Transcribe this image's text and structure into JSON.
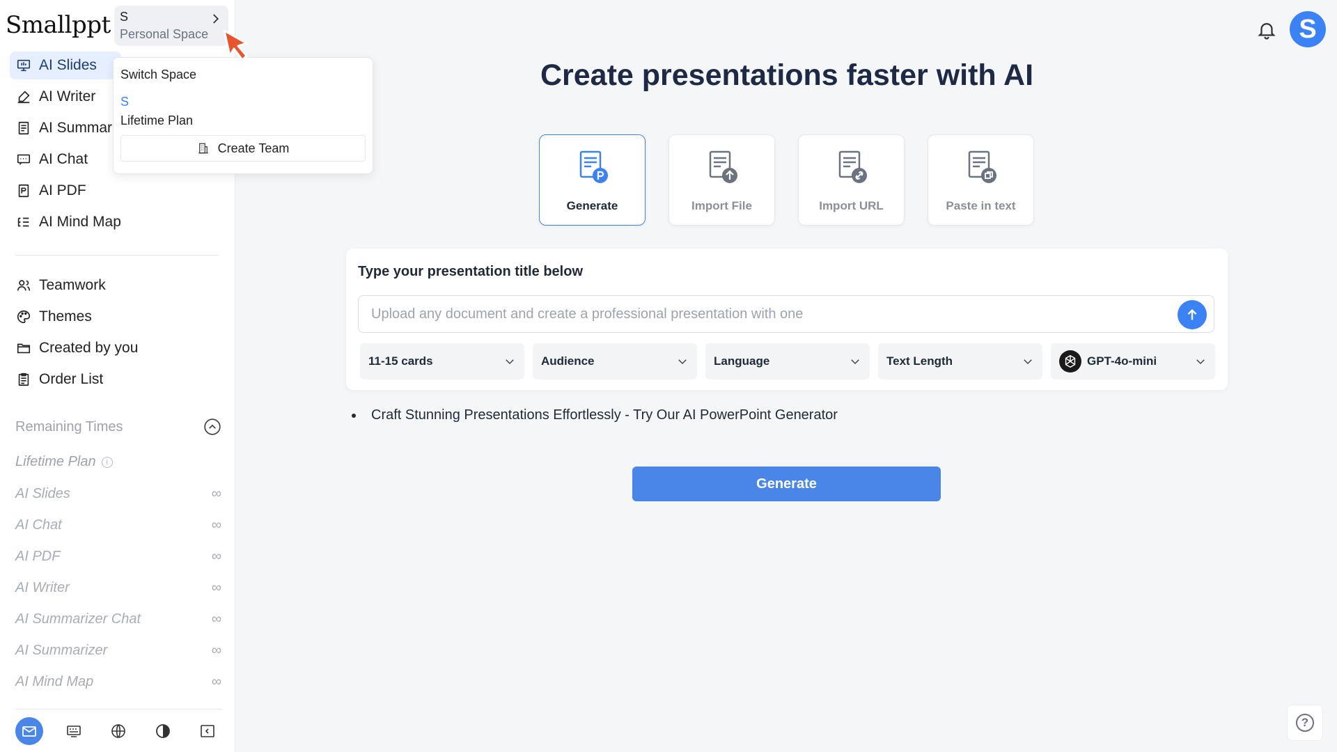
{
  "brand": {
    "logo": "Smallppt",
    "accent": "#3b82f6"
  },
  "space": {
    "name": "S",
    "subtitle": "Personal Space"
  },
  "space_menu": {
    "title": "Switch Space",
    "space_name": "S",
    "plan": "Lifetime Plan",
    "create_team": "Create Team"
  },
  "sidebar": {
    "nav": [
      {
        "label": "AI Slides",
        "icon": "slides-icon"
      },
      {
        "label": "AI Writer",
        "icon": "pen-icon"
      },
      {
        "label": "AI Summarizer",
        "icon": "document-icon"
      },
      {
        "label": "AI Chat",
        "icon": "chat-icon"
      },
      {
        "label": "AI PDF",
        "icon": "pdf-icon"
      },
      {
        "label": "AI Mind Map",
        "icon": "mindmap-icon"
      }
    ],
    "nav2": [
      {
        "label": "Teamwork",
        "icon": "team-icon"
      },
      {
        "label": "Themes",
        "icon": "palette-icon"
      },
      {
        "label": "Created by you",
        "icon": "folder-icon"
      },
      {
        "label": "Order List",
        "icon": "clipboard-icon"
      }
    ],
    "remaining": {
      "title": "Remaining Times",
      "plan": "Lifetime Plan",
      "info": "i",
      "items": [
        {
          "label": "AI Slides",
          "value": "∞"
        },
        {
          "label": "AI Chat",
          "value": "∞"
        },
        {
          "label": "AI PDF",
          "value": "∞"
        },
        {
          "label": "AI Writer",
          "value": "∞"
        },
        {
          "label": "AI Summarizer Chat",
          "value": "∞"
        },
        {
          "label": "AI Summarizer",
          "value": "∞"
        },
        {
          "label": "AI Mind Map",
          "value": "∞"
        }
      ]
    }
  },
  "header": {
    "avatar": "S"
  },
  "main": {
    "title": "Create presentations faster with AI",
    "modes": [
      {
        "label": "Generate",
        "icon": "generate-icon",
        "active": true
      },
      {
        "label": "Import File",
        "icon": "import-file-icon",
        "active": false
      },
      {
        "label": "Import URL",
        "icon": "import-url-icon",
        "active": false
      },
      {
        "label": "Paste in text",
        "icon": "paste-text-icon",
        "active": false
      }
    ],
    "panel_label": "Type your presentation title below",
    "input_placeholder": "Upload any document and create a professional presentation with one",
    "selects": [
      "11-15 cards",
      "Audience",
      "Language",
      "Text Length",
      "GPT-4o-mini"
    ],
    "tip": "Craft Stunning Presentations Effortlessly - Try Our AI PowerPoint Generator",
    "generate_button": "Generate"
  },
  "help": "?"
}
